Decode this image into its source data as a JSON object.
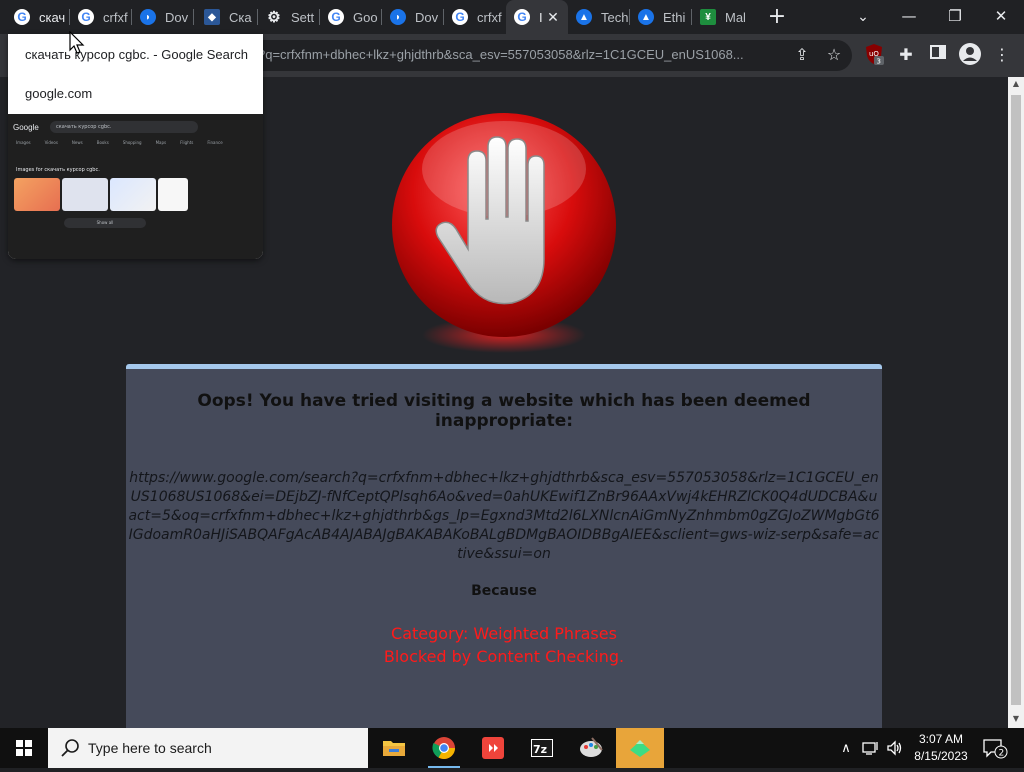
{
  "browser": {
    "tabs": [
      {
        "title": "скач",
        "favicon": "google-icon"
      },
      {
        "title": "crfxf",
        "favicon": "google-icon"
      },
      {
        "title": "Dov",
        "favicon": "download-site-icon"
      },
      {
        "title": "Ска",
        "favicon": "codepen-icon"
      },
      {
        "title": "Sett",
        "favicon": "gear-icon"
      },
      {
        "title": "Goo",
        "favicon": "google-icon"
      },
      {
        "title": "Dov",
        "favicon": "download-site-icon"
      },
      {
        "title": "crfxf",
        "favicon": "google-icon"
      },
      {
        "title": "I",
        "favicon": "google-icon",
        "active": true
      },
      {
        "title": "Tech",
        "favicon": "triangle-icon"
      },
      {
        "title": "Ethi",
        "favicon": "triangle-icon"
      },
      {
        "title": "Mal",
        "favicon": "malware-site-icon"
      }
    ],
    "address_bar": {
      "url": "?q=crfxfnm+dbhec+lkz+ghjdthrb&sca_esv=557053058&rlz=1C1GCEU_enUS1068..."
    },
    "extension_badge": "3",
    "tab_hover_card": {
      "title": "скачать курсор cgbc. - Google Search",
      "domain": "google.com",
      "preview": {
        "logo": "Google",
        "query": "скачать курсор cgbc.",
        "tabs": [
          "Images",
          "Videos",
          "News",
          "Books",
          "Shopping",
          "Maps",
          "Flights",
          "Finance"
        ],
        "heading": "Images for скачать курсор cgbc.",
        "show_all": "Show all"
      }
    }
  },
  "blocked_page": {
    "message": "Oops! You have tried visiting a website which has been deemed inappropriate:",
    "url": "https://www.google.com/search?q=crfxfnm+dbhec+lkz+ghjdthrb&sca_esv=557053058&rlz=1C1GCEU_enUS1068US1068&ei=DEjbZJ-fNfCeptQPlsqh6Ao&ved=0ahUKEwif1ZnBr96AAxVwj4kEHRZlCK0Q4dUDCBA&uact=5&oq=crfxfnm+dbhec+lkz+ghjdthrb&gs_lp=Egxnd3Mtd2l6LXNlcnAiGmNyZnhmbm0gZGJoZWMgbGt6IGdoamR0aHJiSABQAFgAcAB4AJABAJgBAKABAKoBALgBDMgBAOIDBBgAIEE&sclient=gws-wiz-serp&safe=active&ssui=on",
    "because": "Because",
    "reason_category": "Category: Weighted Phrases",
    "reason_detail": "Blocked by Content Checking.",
    "accent_color": "#a5c8ec",
    "reason_color": "#ff1a1a"
  },
  "taskbar": {
    "search_placeholder": "Type here to search",
    "apps": [
      "file-explorer-icon",
      "chrome-icon",
      "anydesk-icon",
      "7zip-icon",
      "paint-icon",
      "app-icon"
    ],
    "time": "3:07 AM",
    "date": "8/15/2023",
    "notification_count": "2"
  }
}
